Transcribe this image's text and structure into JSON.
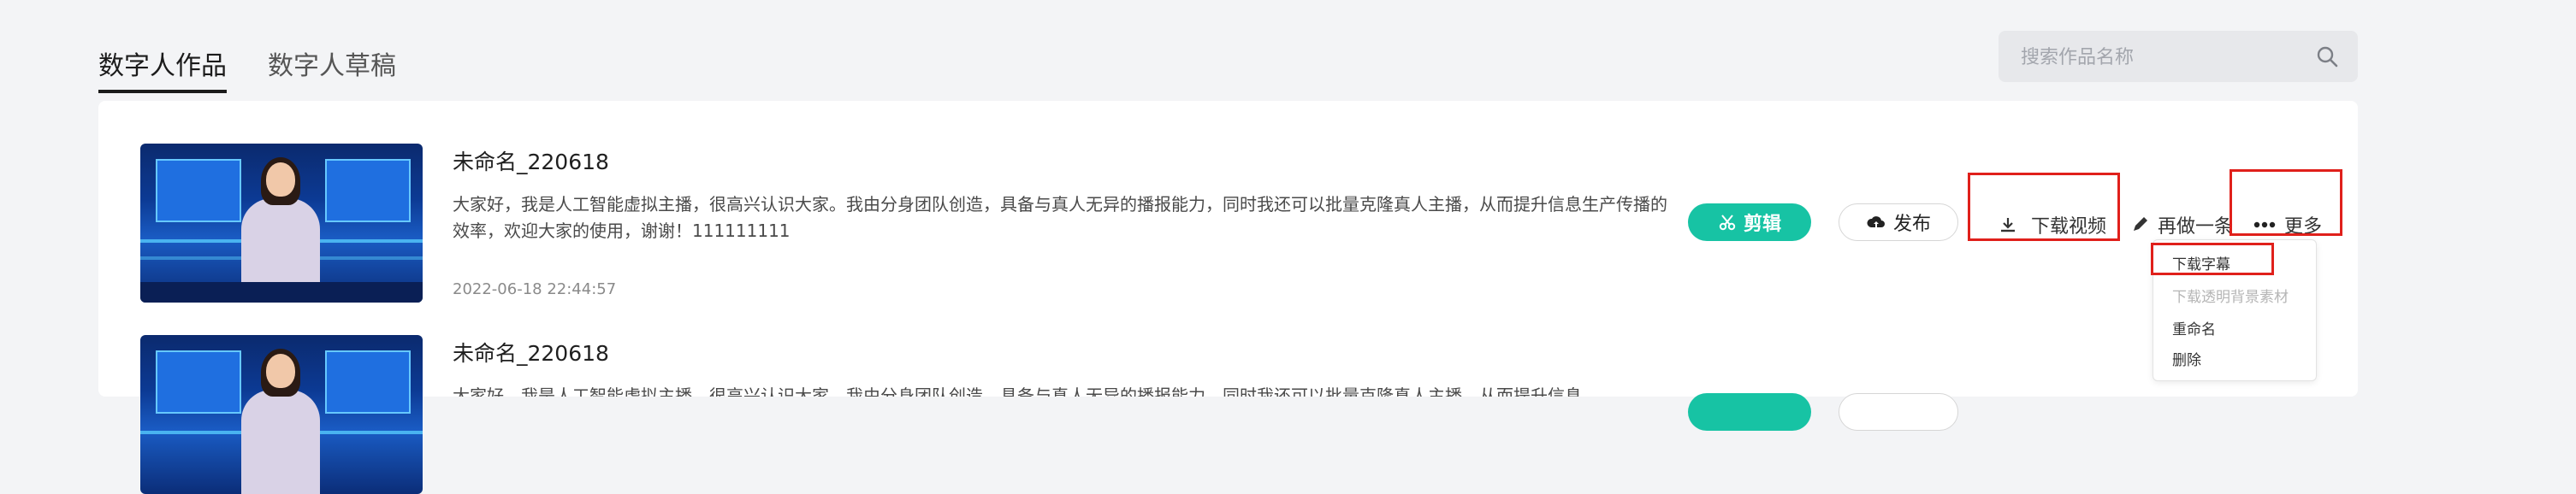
{
  "tabs": [
    {
      "label": "数字人作品",
      "active": true
    },
    {
      "label": "数字人草稿",
      "active": false
    }
  ],
  "search": {
    "placeholder": "搜索作品名称",
    "value": ""
  },
  "works": [
    {
      "title": "未命名_220618",
      "description": "大家好，我是人工智能虚拟主播，很高兴认识大家。我由分身团队创造，具备与真人无异的播报能力，同时我还可以批量克隆真人主播，从而提升信息生产传播的效率，欢迎大家的使用，谢谢！111111111",
      "date": "2022-06-18 22:44:57"
    },
    {
      "title": "未命名_220618",
      "description": "大家好，我是人工智能虚拟主播，很高兴认识大家。我由分身团队创造，具备与真人无异的播报能力，同时我还可以批量克隆真人主播，从而提升信息"
    }
  ],
  "actions": {
    "edit": "剪辑",
    "publish": "发布",
    "download_video": "下载视频",
    "remake": "再做一条",
    "more": "更多"
  },
  "more_menu": [
    {
      "label": "下载字幕",
      "enabled": true
    },
    {
      "label": "下载透明背景素材",
      "enabled": false
    },
    {
      "label": "重命名",
      "enabled": true
    },
    {
      "label": "删除",
      "enabled": true
    }
  ],
  "colors": {
    "accent": "#17c3a4",
    "highlight_box": "#e0201b",
    "page_bg": "#f3f4f6"
  },
  "icons": [
    "search-icon",
    "scissors-icon",
    "upload-cloud-icon",
    "download-icon",
    "pencil-icon",
    "more-dots-icon"
  ]
}
